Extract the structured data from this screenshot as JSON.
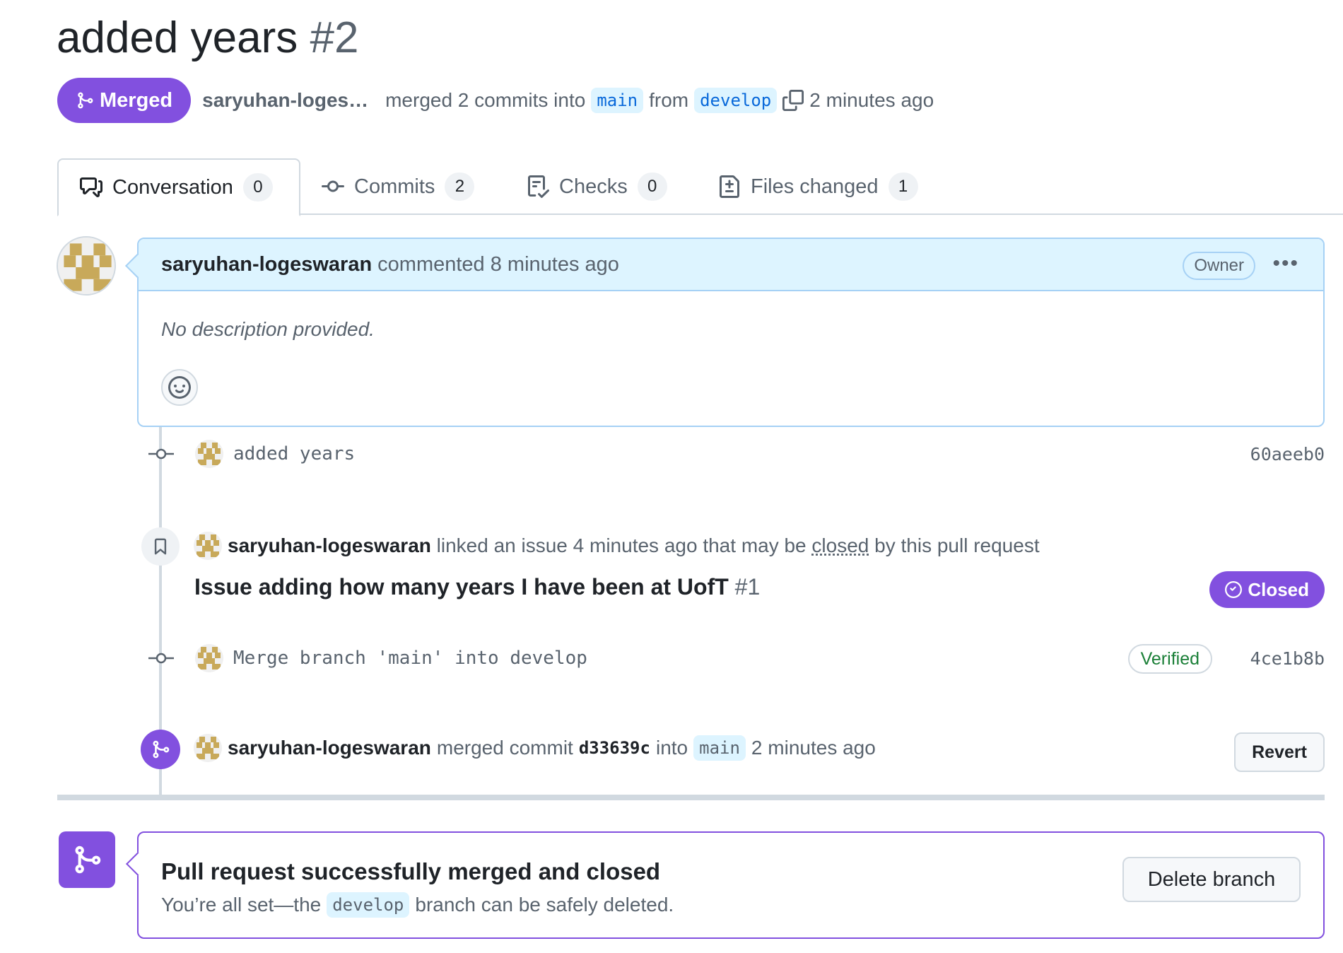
{
  "pr": {
    "title": "added years",
    "number": "#2",
    "state": "Merged",
    "author": "saryuhan-loges…",
    "merge_text": "merged 2 commits into",
    "base_branch": "main",
    "from_text": "from",
    "head_branch": "develop",
    "time": "2 minutes ago"
  },
  "tabs": [
    {
      "label": "Conversation",
      "count": "0",
      "icon": "comment-discussion-icon"
    },
    {
      "label": "Commits",
      "count": "2",
      "icon": "git-commit-icon"
    },
    {
      "label": "Checks",
      "count": "0",
      "icon": "checklist-icon"
    },
    {
      "label": "Files changed",
      "count": "1",
      "icon": "file-diff-icon"
    }
  ],
  "comment": {
    "author": "saryuhan-logeswaran",
    "action": "commented 8 minutes ago",
    "role": "Owner",
    "body": "No description provided."
  },
  "timeline": {
    "commit1": {
      "message": "added years",
      "sha": "60aeeb0"
    },
    "linked": {
      "author": "saryuhan-logeswaran",
      "text1": "linked an issue 4 minutes ago that may be",
      "closed_word": "closed",
      "text2": "by this pull request",
      "issue_title": "Issue adding how many years I have been at UofT",
      "issue_number": "#1",
      "issue_state": "Closed"
    },
    "commit2": {
      "message": "Merge branch 'main' into develop",
      "verified": "Verified",
      "sha": "4ce1b8b"
    },
    "merge": {
      "author": "saryuhan-logeswaran",
      "text1": "merged commit",
      "sha": "d33639c",
      "text2": "into",
      "branch": "main",
      "time": "2 minutes ago",
      "revert_label": "Revert"
    }
  },
  "merged_box": {
    "title": "Pull request successfully merged and closed",
    "sub1": "You’re all set—the",
    "branch": "develop",
    "sub2": "branch can be safely deleted.",
    "delete_label": "Delete branch"
  },
  "colors": {
    "merged_purple": "#8250df",
    "accent_blue": "#0969da",
    "verified_green": "#1a7f37",
    "comment_header_bg": "#ddf4ff",
    "avatar_gold": "#c8a95a"
  }
}
